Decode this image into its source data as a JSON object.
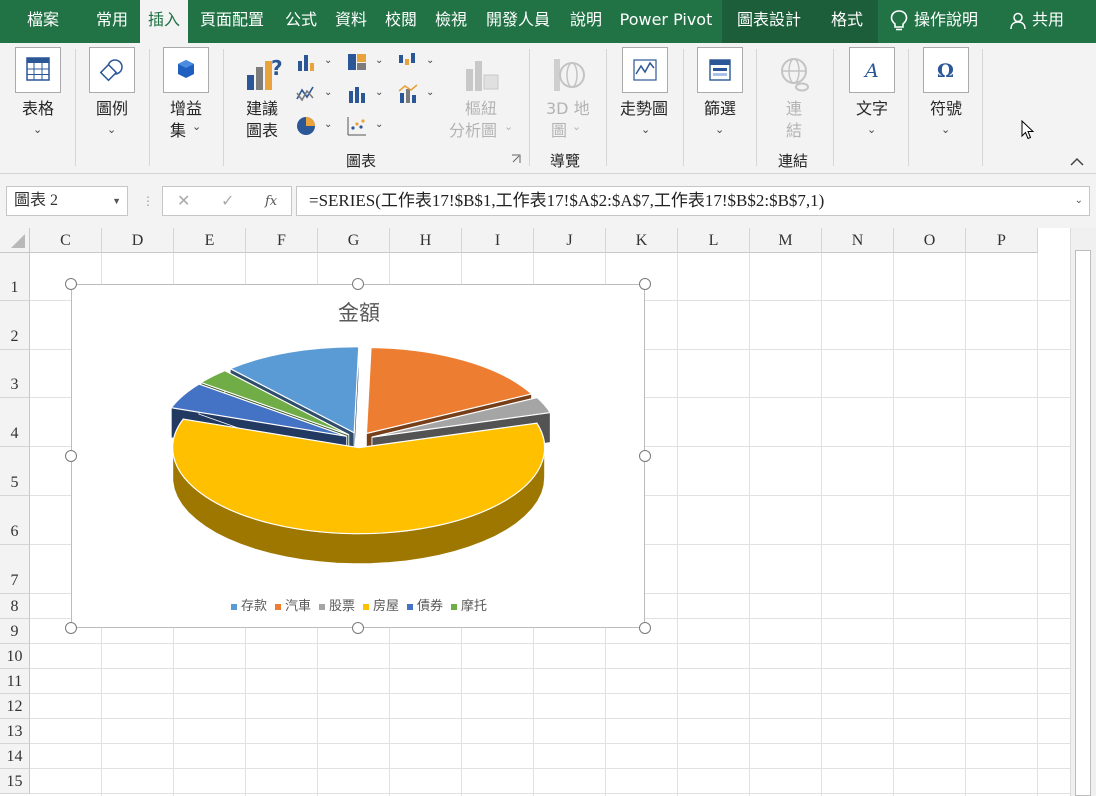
{
  "tabs": [
    {
      "id": "file",
      "label": "檔案"
    },
    {
      "id": "home",
      "label": "常用"
    },
    {
      "id": "insert",
      "label": "插入"
    },
    {
      "id": "layout",
      "label": "頁面配置"
    },
    {
      "id": "formulas",
      "label": "公式"
    },
    {
      "id": "data",
      "label": "資料"
    },
    {
      "id": "review",
      "label": "校閱"
    },
    {
      "id": "view",
      "label": "檢視"
    },
    {
      "id": "developer",
      "label": "開發人員"
    },
    {
      "id": "help",
      "label": "說明"
    },
    {
      "id": "powerpivot",
      "label": "Power Pivot"
    },
    {
      "id": "chartdesign",
      "label": "圖表設計"
    },
    {
      "id": "format",
      "label": "格式"
    }
  ],
  "active_tab": "插入",
  "tell_me": "操作說明",
  "share": "共用",
  "ribbon": {
    "table": "表格",
    "illustrations": "圖例",
    "addins_1": "增益",
    "addins_2": "集",
    "recommended_1": "建議",
    "recommended_2": "圖表",
    "pivotchart_1": "樞紐",
    "pivotchart_2": "分析圖",
    "map3d_1": "3D 地",
    "map3d_2": "圖",
    "sparklines": "走勢圖",
    "filters": "篩選",
    "link_1": "連",
    "link_2": "結",
    "text": "文字",
    "symbols": "符號",
    "group_charts": "圖表",
    "group_tours": "導覽",
    "group_links": "連結"
  },
  "formula_bar": {
    "name_box": "圖表 2",
    "fx": "fx",
    "formula": "=SERIES(工作表17!$B$1,工作表17!$A$2:$A$7,工作表17!$B$2:$B$7,1)"
  },
  "columns": [
    "C",
    "D",
    "E",
    "F",
    "G",
    "H",
    "I",
    "J",
    "K",
    "L",
    "M",
    "N",
    "O",
    "P"
  ],
  "rows": [
    "1",
    "2",
    "3",
    "4",
    "5",
    "6",
    "7",
    "8",
    "9",
    "10",
    "11",
    "12",
    "13",
    "14",
    "15"
  ],
  "chart_data": {
    "type": "pie",
    "title": "金額",
    "style": "3d-exploded",
    "categories": [
      "存款",
      "汽車",
      "股票",
      "房屋",
      "債券",
      "摩托"
    ],
    "values": [
      12,
      17,
      3,
      60,
      5,
      3
    ],
    "colors": [
      "#5b9bd5",
      "#ed7d31",
      "#a5a5a5",
      "#ffc000",
      "#4472c4",
      "#70ad47"
    ],
    "legend_position": "bottom"
  }
}
